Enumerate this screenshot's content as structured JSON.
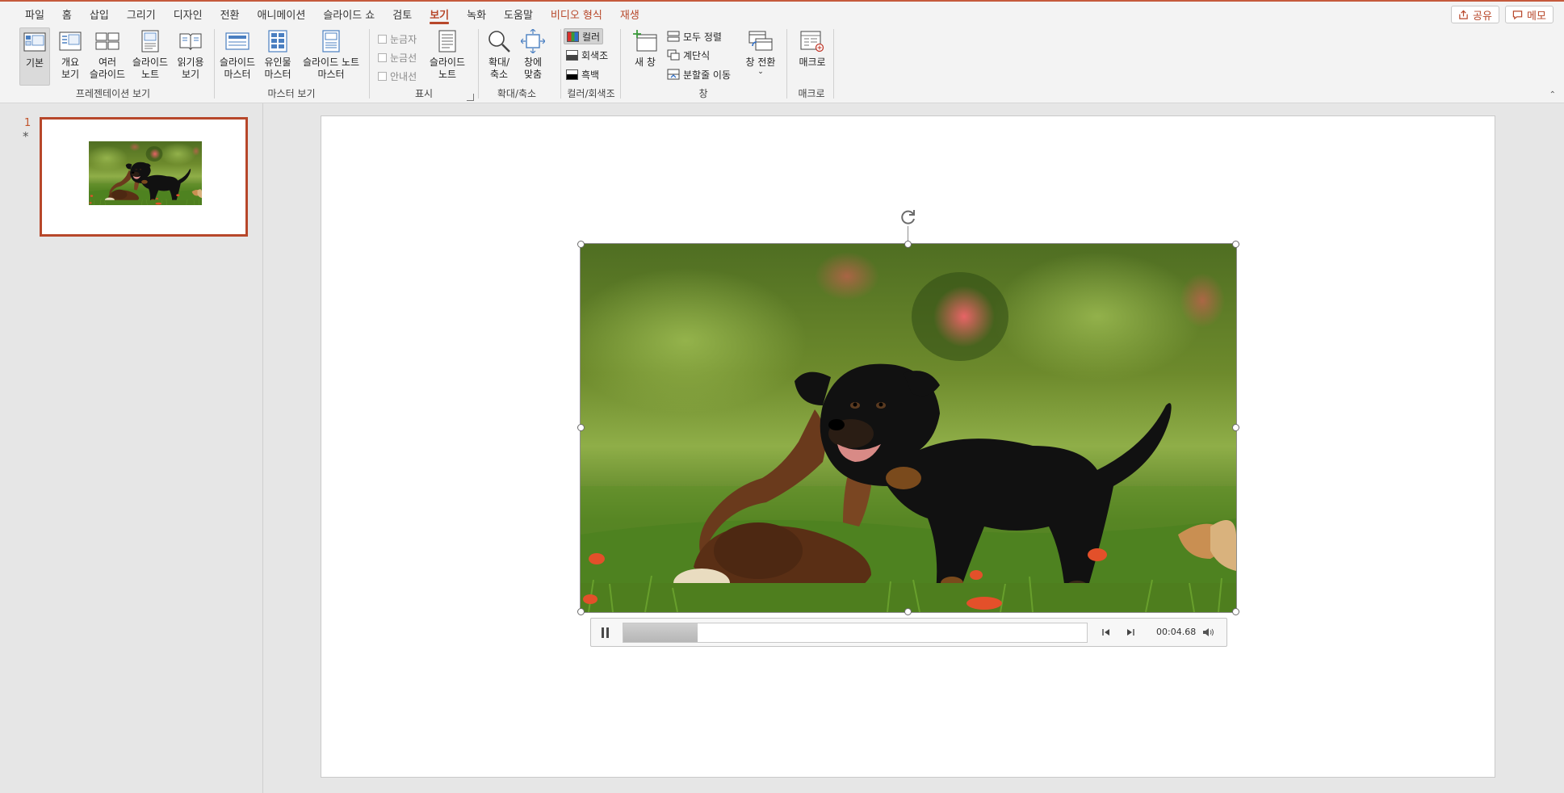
{
  "tabs": [
    "파일",
    "홈",
    "삽입",
    "그리기",
    "디자인",
    "전환",
    "애니메이션",
    "슬라이드 쇼",
    "검토",
    "보기",
    "녹화",
    "도움말",
    "비디오 형식",
    "재생"
  ],
  "active_tab": "보기",
  "share_button": "공유",
  "memo_button": "메모",
  "ribbon": {
    "presentation_views": {
      "label": "프레젠테이션 보기",
      "normal": "기본",
      "outline_l1": "개요",
      "outline_l2": "보기",
      "sorter_l1": "여러",
      "sorter_l2": "슬라이드",
      "notes_l1": "슬라이드",
      "notes_l2": "노트",
      "reading_l1": "읽기용",
      "reading_l2": "보기"
    },
    "master_views": {
      "label": "마스터 보기",
      "slide_master_l1": "슬라이드",
      "slide_master_l2": "마스터",
      "handout_master_l1": "유인물",
      "handout_master_l2": "마스터",
      "notes_master_l1": "슬라이드 노트",
      "notes_master_l2": "마스터"
    },
    "show": {
      "label": "표시",
      "ruler": "눈금자",
      "gridlines": "눈금선",
      "guides": "안내선",
      "notes_l1": "슬라이드",
      "notes_l2": "노트"
    },
    "zoom": {
      "label": "확대/축소",
      "zoom_l1": "확대/",
      "zoom_l2": "축소",
      "fit_l1": "창에",
      "fit_l2": "맞춤"
    },
    "color": {
      "label": "컬러/회색조",
      "color": "컬러",
      "grayscale": "회색조",
      "bw": "흑백"
    },
    "window": {
      "label": "창",
      "new_window": "새 창",
      "arrange_all": "모두 정렬",
      "cascade": "계단식",
      "move_split": "분할줄 이동",
      "switch_window": "창 전환"
    },
    "macros": {
      "label": "매크로",
      "macros": "매크로"
    }
  },
  "thumbnails": [
    {
      "number": "1",
      "marker": "*"
    }
  ],
  "video": {
    "current_time": "00:04.68",
    "progress": 0.16,
    "subject": "two puppies playing on grass"
  },
  "colors": {
    "accent": "#b7472a",
    "ribbon_bg": "#f3f3f3",
    "workspace_bg": "#e6e6e6"
  }
}
